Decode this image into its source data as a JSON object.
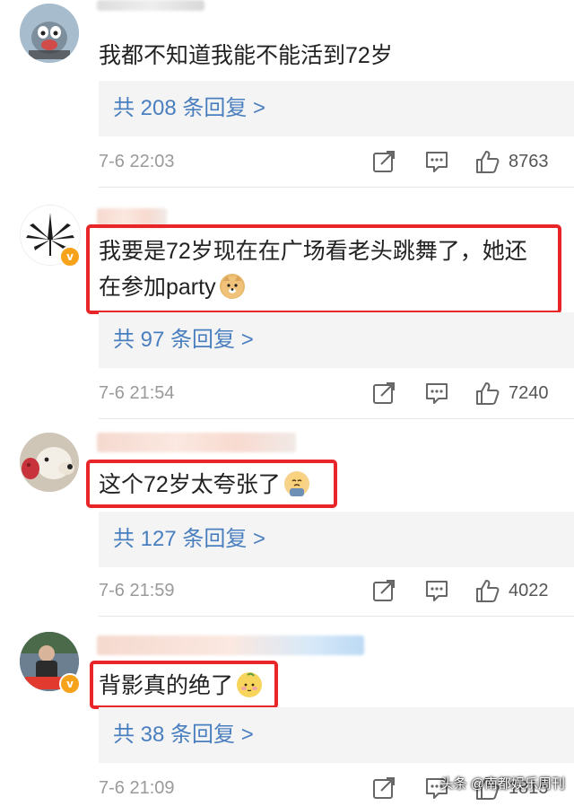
{
  "comments": [
    {
      "text": "我都不知道我能不能活到72岁",
      "text_line2": "",
      "replies": "共 208 条回复 >",
      "time": "7-6 22:03",
      "likes": "8763",
      "highlighted": false
    },
    {
      "text": "我要是72岁现在在广场看老头跳舞了，她还",
      "text_line2": "在参加party",
      "replies": "共 97 条回复 >",
      "time": "7-6 21:54",
      "likes": "7240",
      "highlighted": true
    },
    {
      "text": "这个72岁太夸张了",
      "text_line2": "",
      "replies": "共 127 条回复 >",
      "time": "7-6 21:59",
      "likes": "4022",
      "highlighted": true
    },
    {
      "text": "背影真的绝了",
      "text_line2": "",
      "replies": "共 38 条回复 >",
      "time": "7-6 21:09",
      "likes": "1815",
      "highlighted": true
    }
  ],
  "watermark": "头条 @南都娱乐周刊",
  "colors": {
    "highlight_border": "#e8262a",
    "reply_link": "#4a7fbf",
    "reply_bg": "#f4f4f4",
    "verified_badge": "#f7a21b"
  },
  "icons": [
    "share-icon",
    "comment-icon",
    "like-icon",
    "verified-badge-icon"
  ]
}
